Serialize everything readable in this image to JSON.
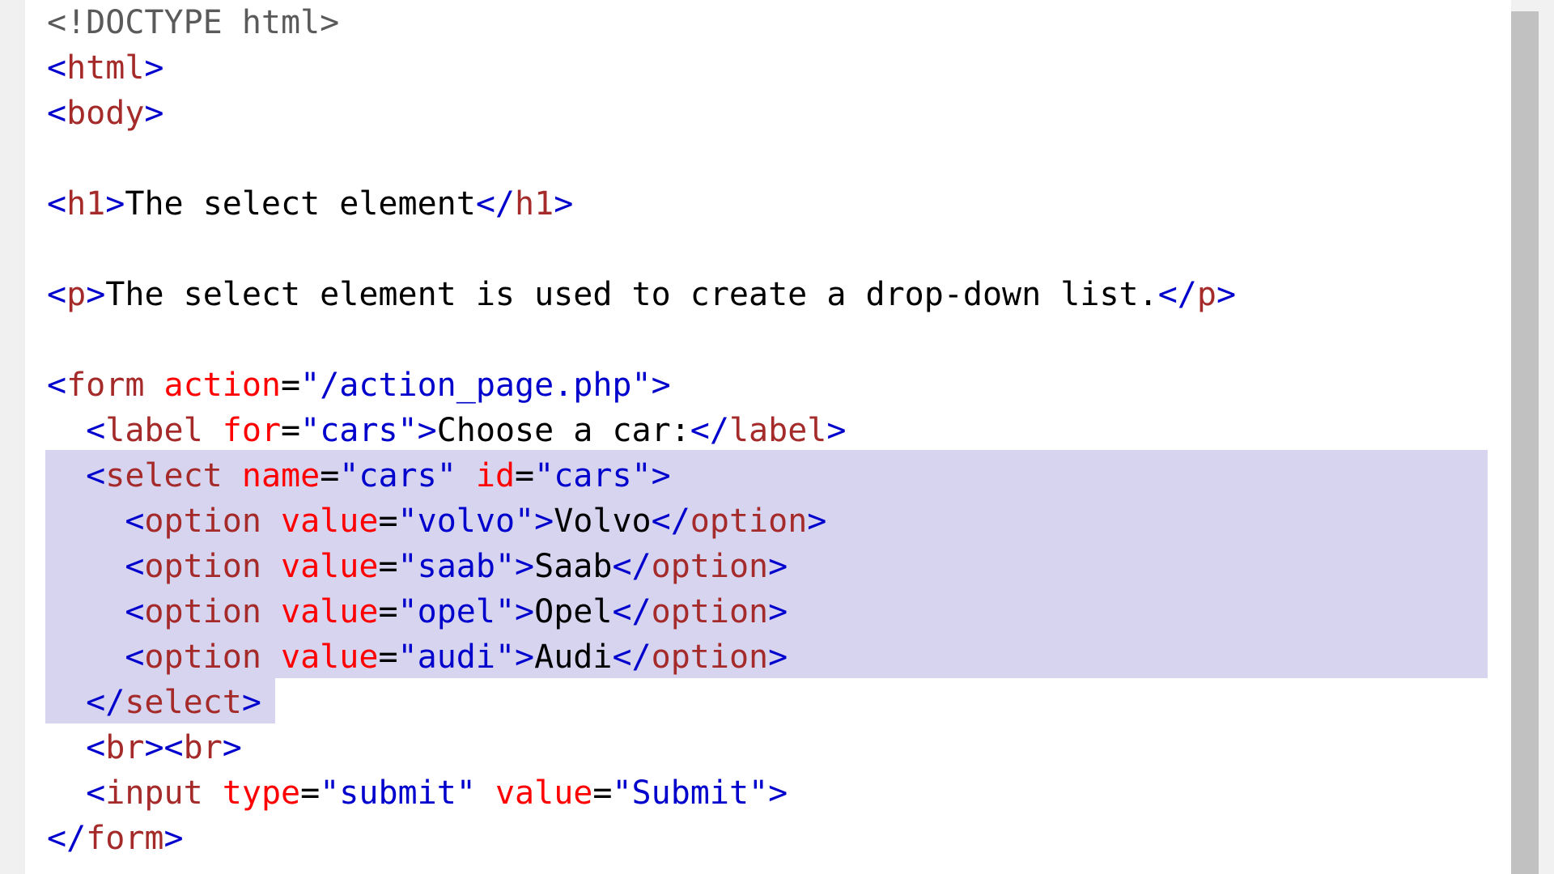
{
  "lines": [
    [
      {
        "t": "<!DOCTYPE html>",
        "c": "com"
      }
    ],
    [
      {
        "t": "<",
        "c": "br"
      },
      {
        "t": "html",
        "c": "tag"
      },
      {
        "t": ">",
        "c": "br"
      }
    ],
    [
      {
        "t": "<",
        "c": "br"
      },
      {
        "t": "body",
        "c": "tag"
      },
      {
        "t": ">",
        "c": "br"
      }
    ],
    [],
    [
      {
        "t": "<",
        "c": "br"
      },
      {
        "t": "h1",
        "c": "tag"
      },
      {
        "t": ">",
        "c": "br"
      },
      {
        "t": "The select element",
        "c": "txt"
      },
      {
        "t": "</",
        "c": "br"
      },
      {
        "t": "h1",
        "c": "tag"
      },
      {
        "t": ">",
        "c": "br"
      }
    ],
    [],
    [
      {
        "t": "<",
        "c": "br"
      },
      {
        "t": "p",
        "c": "tag"
      },
      {
        "t": ">",
        "c": "br"
      },
      {
        "t": "The select element is used to create a drop-down list.",
        "c": "txt"
      },
      {
        "t": "</",
        "c": "br"
      },
      {
        "t": "p",
        "c": "tag"
      },
      {
        "t": ">",
        "c": "br"
      }
    ],
    [],
    [
      {
        "t": "<",
        "c": "br"
      },
      {
        "t": "form",
        "c": "tag"
      },
      {
        "t": " ",
        "c": "txt"
      },
      {
        "t": "action",
        "c": "attr"
      },
      {
        "t": "=",
        "c": "txt"
      },
      {
        "t": "\"/action_page.php\"",
        "c": "val"
      },
      {
        "t": ">",
        "c": "br"
      }
    ],
    [
      {
        "t": "  ",
        "c": "txt"
      },
      {
        "t": "<",
        "c": "br"
      },
      {
        "t": "label",
        "c": "tag"
      },
      {
        "t": " ",
        "c": "txt"
      },
      {
        "t": "for",
        "c": "attr"
      },
      {
        "t": "=",
        "c": "txt"
      },
      {
        "t": "\"cars\"",
        "c": "val"
      },
      {
        "t": ">",
        "c": "br"
      },
      {
        "t": "Choose a car:",
        "c": "txt"
      },
      {
        "t": "</",
        "c": "br"
      },
      {
        "t": "label",
        "c": "tag"
      },
      {
        "t": ">",
        "c": "br"
      }
    ],
    [
      {
        "t": "  ",
        "c": "txt"
      },
      {
        "t": "<",
        "c": "br"
      },
      {
        "t": "select",
        "c": "tag"
      },
      {
        "t": " ",
        "c": "txt"
      },
      {
        "t": "name",
        "c": "attr"
      },
      {
        "t": "=",
        "c": "txt"
      },
      {
        "t": "\"cars\"",
        "c": "val"
      },
      {
        "t": " ",
        "c": "txt"
      },
      {
        "t": "id",
        "c": "attr"
      },
      {
        "t": "=",
        "c": "txt"
      },
      {
        "t": "\"cars\"",
        "c": "val"
      },
      {
        "t": ">",
        "c": "br"
      }
    ],
    [
      {
        "t": "    ",
        "c": "txt"
      },
      {
        "t": "<",
        "c": "br"
      },
      {
        "t": "option",
        "c": "tag"
      },
      {
        "t": " ",
        "c": "txt"
      },
      {
        "t": "value",
        "c": "attr"
      },
      {
        "t": "=",
        "c": "txt"
      },
      {
        "t": "\"volvo\"",
        "c": "val"
      },
      {
        "t": ">",
        "c": "br"
      },
      {
        "t": "Volvo",
        "c": "txt"
      },
      {
        "t": "</",
        "c": "br"
      },
      {
        "t": "option",
        "c": "tag"
      },
      {
        "t": ">",
        "c": "br"
      }
    ],
    [
      {
        "t": "    ",
        "c": "txt"
      },
      {
        "t": "<",
        "c": "br"
      },
      {
        "t": "option",
        "c": "tag"
      },
      {
        "t": " ",
        "c": "txt"
      },
      {
        "t": "value",
        "c": "attr"
      },
      {
        "t": "=",
        "c": "txt"
      },
      {
        "t": "\"saab\"",
        "c": "val"
      },
      {
        "t": ">",
        "c": "br"
      },
      {
        "t": "Saab",
        "c": "txt"
      },
      {
        "t": "</",
        "c": "br"
      },
      {
        "t": "option",
        "c": "tag"
      },
      {
        "t": ">",
        "c": "br"
      }
    ],
    [
      {
        "t": "    ",
        "c": "txt"
      },
      {
        "t": "<",
        "c": "br"
      },
      {
        "t": "option",
        "c": "tag"
      },
      {
        "t": " ",
        "c": "txt"
      },
      {
        "t": "value",
        "c": "attr"
      },
      {
        "t": "=",
        "c": "txt"
      },
      {
        "t": "\"opel\"",
        "c": "val"
      },
      {
        "t": ">",
        "c": "br"
      },
      {
        "t": "Opel",
        "c": "txt"
      },
      {
        "t": "</",
        "c": "br"
      },
      {
        "t": "option",
        "c": "tag"
      },
      {
        "t": ">",
        "c": "br"
      }
    ],
    [
      {
        "t": "    ",
        "c": "txt"
      },
      {
        "t": "<",
        "c": "br"
      },
      {
        "t": "option",
        "c": "tag"
      },
      {
        "t": " ",
        "c": "txt"
      },
      {
        "t": "value",
        "c": "attr"
      },
      {
        "t": "=",
        "c": "txt"
      },
      {
        "t": "\"audi\"",
        "c": "val"
      },
      {
        "t": ">",
        "c": "br"
      },
      {
        "t": "Audi",
        "c": "txt"
      },
      {
        "t": "</",
        "c": "br"
      },
      {
        "t": "option",
        "c": "tag"
      },
      {
        "t": ">",
        "c": "br"
      }
    ],
    [
      {
        "t": "  ",
        "c": "txt"
      },
      {
        "t": "</",
        "c": "br"
      },
      {
        "t": "select",
        "c": "tag"
      },
      {
        "t": ">",
        "c": "br"
      }
    ],
    [
      {
        "t": "  ",
        "c": "txt"
      },
      {
        "t": "<",
        "c": "br"
      },
      {
        "t": "br",
        "c": "tag"
      },
      {
        "t": "><",
        "c": "br"
      },
      {
        "t": "br",
        "c": "tag"
      },
      {
        "t": ">",
        "c": "br"
      }
    ],
    [
      {
        "t": "  ",
        "c": "txt"
      },
      {
        "t": "<",
        "c": "br"
      },
      {
        "t": "input",
        "c": "tag"
      },
      {
        "t": " ",
        "c": "txt"
      },
      {
        "t": "type",
        "c": "attr"
      },
      {
        "t": "=",
        "c": "txt"
      },
      {
        "t": "\"submit\"",
        "c": "val"
      },
      {
        "t": " ",
        "c": "txt"
      },
      {
        "t": "value",
        "c": "attr"
      },
      {
        "t": "=",
        "c": "txt"
      },
      {
        "t": "\"Submit\"",
        "c": "val"
      },
      {
        "t": ">",
        "c": "br"
      }
    ],
    [
      {
        "t": "</",
        "c": "br"
      },
      {
        "t": "form",
        "c": "tag"
      },
      {
        "t": ">",
        "c": "br"
      }
    ]
  ],
  "colors": {
    "tag": "#a52a2a",
    "attribute": "#ff0000",
    "value": "#0000cd",
    "bracket": "#0000cd",
    "selection": "#d7d4f0"
  }
}
